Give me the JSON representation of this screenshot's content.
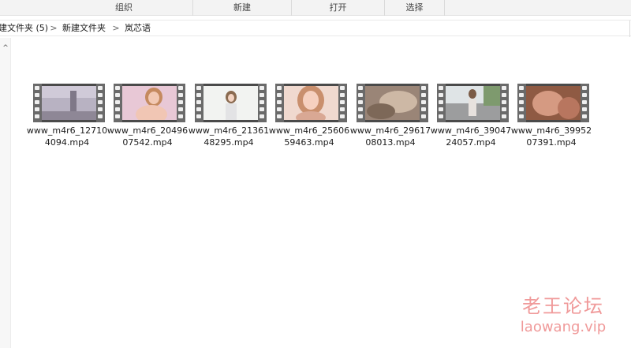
{
  "ribbon": {
    "groups": [
      "组织",
      "新建",
      "打开",
      "选择"
    ]
  },
  "address": {
    "crumbs": [
      "建文件夹 (5)",
      "新建文件夹",
      "岚芯语"
    ],
    "separator": ">"
  },
  "navigation": {
    "scroll_up_glyph": "^"
  },
  "files": [
    {
      "name": "www_m4r6_127104094.mp4",
      "type": "video"
    },
    {
      "name": "www_m4r6_2049607542.mp4",
      "type": "video"
    },
    {
      "name": "www_m4r6_2136148295.mp4",
      "type": "video"
    },
    {
      "name": "www_m4r6_2560659463.mp4",
      "type": "video"
    },
    {
      "name": "www_m4r6_2961708013.mp4",
      "type": "video"
    },
    {
      "name": "www_m4r6_3904724057.mp4",
      "type": "video"
    },
    {
      "name": "www_m4r6_3995207391.mp4",
      "type": "video"
    }
  ],
  "watermark": {
    "text": "老王论坛",
    "url": "laowang.vip"
  },
  "colors": {
    "watermark": "#f09a9a",
    "ribbon_background": "#f3f3f3",
    "film_strip": "#6a6a6a"
  }
}
